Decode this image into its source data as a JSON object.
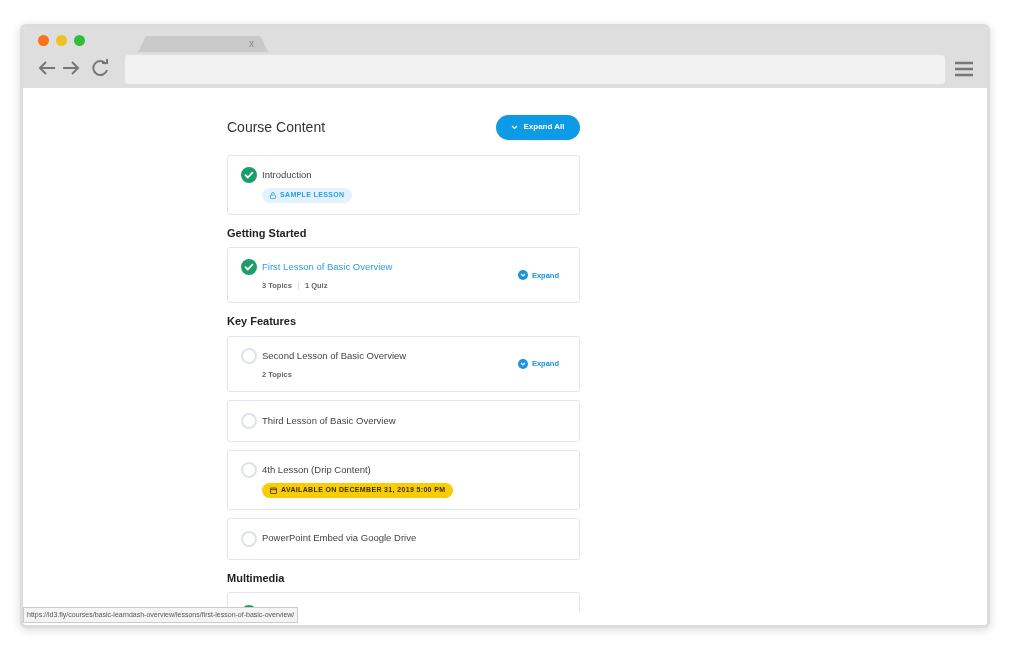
{
  "browser": {
    "tab_close": "x",
    "status_url": "https://ld3.fly/courses/basic-learndash-overview/lessons/first-lesson-of-basic-overview/"
  },
  "page": {
    "title": "Course Content",
    "expand_all": "Expand All"
  },
  "sections": [
    {
      "lessons": [
        {
          "title": "Introduction",
          "completed": true,
          "badge": {
            "kind": "sample",
            "text": "SAMPLE LESSON"
          }
        }
      ]
    },
    {
      "heading": "Getting Started",
      "lessons": [
        {
          "title": "First Lesson of Basic Overview",
          "completed": true,
          "hovered": true,
          "meta": [
            "3 Topics",
            "1 Quiz"
          ],
          "expand": "Expand"
        }
      ]
    },
    {
      "heading": "Key Features",
      "lessons": [
        {
          "title": "Second Lesson of Basic Overview",
          "completed": false,
          "meta": [
            "2 Topics"
          ],
          "expand": "Expand"
        },
        {
          "title": "Third Lesson of Basic Overview",
          "completed": false
        },
        {
          "title": "4th Lesson (Drip Content)",
          "completed": false,
          "badge": {
            "kind": "drip",
            "text": "AVAILABLE ON DECEMBER 31, 2019 5:00 PM"
          }
        },
        {
          "title": "PowerPoint Embed via Google Drive",
          "completed": false
        }
      ]
    },
    {
      "heading": "Multimedia",
      "lessons": [
        {
          "completed": true
        }
      ]
    }
  ]
}
